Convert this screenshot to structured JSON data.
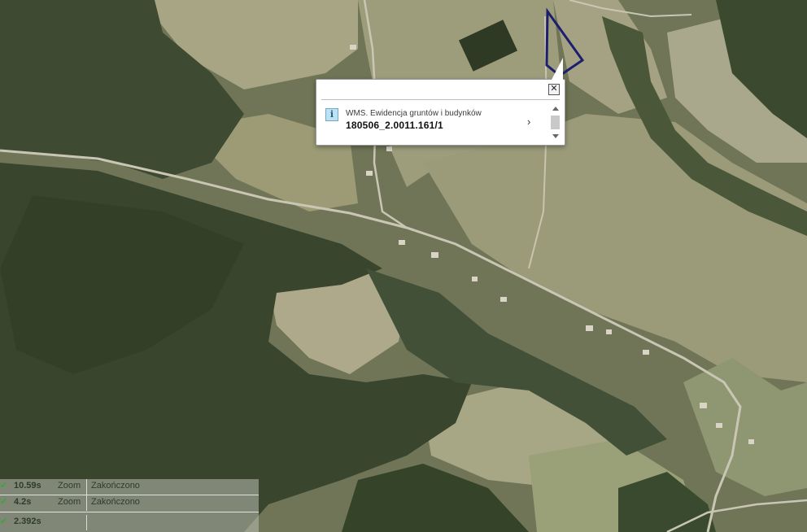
{
  "popup": {
    "layer_name": "WMS. Ewidencja gruntów i budynków",
    "parcel_id": "180506_2.0011.161/1",
    "close_glyph": "✕",
    "info_glyph": "i",
    "more_glyph": "›",
    "icons": {
      "close": "close-icon",
      "info": "info-icon",
      "more": "chevron-right-icon"
    }
  },
  "log": {
    "rows": [
      {
        "time": "10.59s",
        "action": "Zoom",
        "status": "Zakończono"
      },
      {
        "time": "4.2s",
        "action": "Zoom",
        "status": "Zakończono"
      },
      {
        "time": "2.392s",
        "action": "",
        "status": ""
      }
    ],
    "check_glyph": "✔",
    "status_color": "#3aa635"
  },
  "map": {
    "parcel_outline_color": "#1c1f6e",
    "imagery": "aerial-orthophoto"
  }
}
